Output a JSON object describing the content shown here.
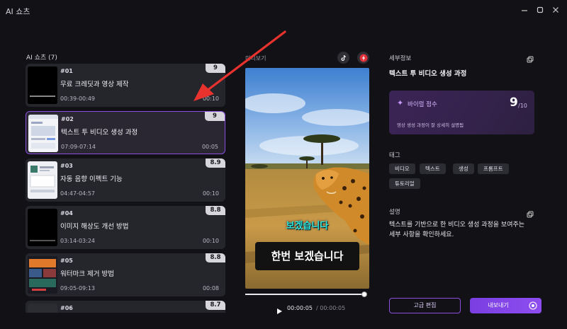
{
  "app": {
    "title": "AI 쇼츠"
  },
  "list": {
    "header": "AI 쇼츠 (7)",
    "clips": [
      {
        "num": "#01",
        "title": "무료 크레딧과 영상 제작",
        "range": "00:39-00:49",
        "duration": "00:10",
        "score": "9"
      },
      {
        "num": "#02",
        "title": "텍스트 투 비디오 생성 과정",
        "range": "07:09-07:14",
        "duration": "00:05",
        "score": "9"
      },
      {
        "num": "#03",
        "title": "자동 음향 이펙트 기능",
        "range": "04:47-04:57",
        "duration": "00:10",
        "score": "8.9"
      },
      {
        "num": "#04",
        "title": "이미지 해상도 개선 방법",
        "range": "03:14-03:24",
        "duration": "00:10",
        "score": "8.8"
      },
      {
        "num": "#05",
        "title": "워터마크 제거 방법",
        "range": "09:05-09:13",
        "duration": "00:08",
        "score": "8.8"
      },
      {
        "num": "#06",
        "title": "",
        "range": "",
        "duration": "",
        "score": "8.7"
      }
    ]
  },
  "preview": {
    "label": "미리보기",
    "subtitle_small": "보겠습니다",
    "subtitle_big": "한번 보겠습니다",
    "time_current": "00:00:05",
    "time_total": "/ 00:00:05",
    "progress": 1.0
  },
  "details": {
    "label": "세부정보",
    "title": "텍스트 투 비디오 생성 과정",
    "viral_label": "바이럴 점수",
    "viral_score": "9",
    "viral_max": "/10",
    "viral_desc": "영상 생성 과정이 잘 상세히 설명됨",
    "tag_label": "태그",
    "tags": [
      "비디오",
      "텍스트",
      "생성",
      "프롬프트",
      "튜토리얼"
    ],
    "desc_label": "설명",
    "desc_text": "텍스트를 기반으로 한 비디오 생성 과정을 보여주는 세부 사항을 확인하세요."
  },
  "buttons": {
    "advanced": "고급 편집",
    "export": "내보내기"
  },
  "colors": {
    "accent": "#8a4fe0",
    "subtitle_teal": "#2ee8d8"
  }
}
